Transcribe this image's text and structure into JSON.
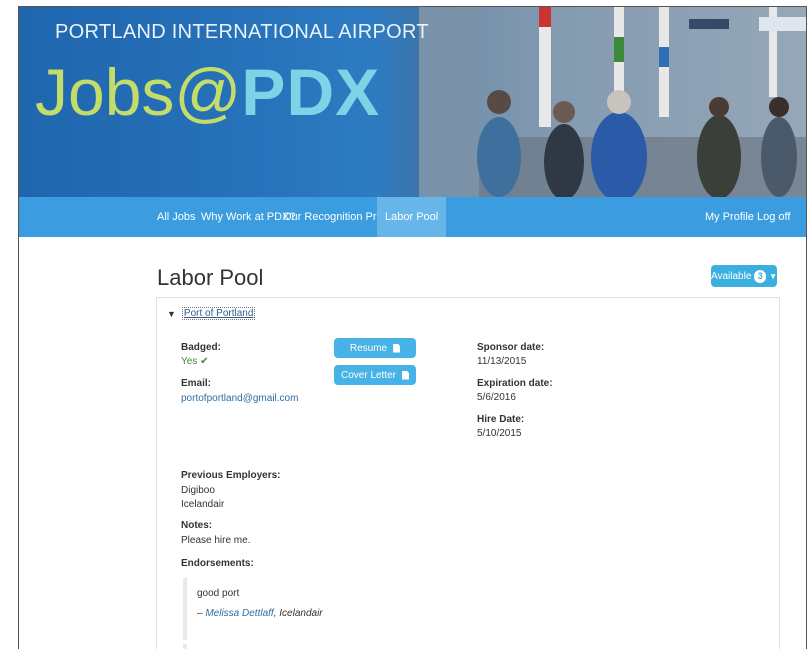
{
  "header": {
    "airport_name": "PORTLAND INTERNATIONAL AIRPORT",
    "logo_jobs": "Jobs",
    "logo_at": "@",
    "logo_pdx": "PDX"
  },
  "nav": {
    "left": [
      "All Jobs",
      "Why Work at PDX?",
      "Our Recognition Program",
      "Labor Pool"
    ],
    "active": "Labor Pool",
    "right": [
      "My Profile",
      "Log off"
    ]
  },
  "page": {
    "title": "Labor Pool",
    "available_label": "Available",
    "available_count": "3"
  },
  "candidate": {
    "employer": "Port of Portland",
    "badged_label": "Badged:",
    "badged_value": "Yes",
    "email_label": "Email:",
    "email_value": "portofportland@gmail.com",
    "resume_label": "Resume",
    "cover_letter_label": "Cover Letter",
    "sponsor_label": "Sponsor date:",
    "sponsor_value": "11/13/2015",
    "expiration_label": "Expiration date:",
    "expiration_value": "5/6/2016",
    "hire_label": "Hire Date:",
    "hire_value": "5/10/2015",
    "prev_employers_label": "Previous Employers:",
    "prev_employers": [
      "Digiboo",
      "Icelandair"
    ],
    "notes_label": "Notes:",
    "notes_value": "Please hire me.",
    "endorsements_label": "Endorsements:",
    "endorsement_text": "good port",
    "endorsement_dash": "–",
    "endorser_name": "Melissa Dettlaff",
    "endorser_org": "Icelandair"
  },
  "colors": {
    "nav_bg": "#3b9de0",
    "nav_active": "#67b6ea",
    "button": "#47b2e6",
    "badged_yes": "#3c8d2f",
    "link": "#2d6da3"
  },
  "icons": [
    "check-icon",
    "chevron-down-icon",
    "document-icon",
    "caret-down-icon"
  ]
}
